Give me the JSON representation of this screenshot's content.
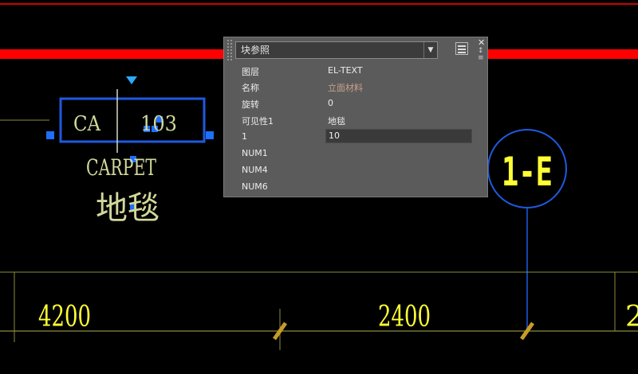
{
  "cad": {
    "block": {
      "left_text": "CA",
      "right_text": "103",
      "label_en": "CARPET",
      "label_cn": "地毯"
    },
    "grid_bubble": "1-E",
    "dimensions": [
      "4200",
      "2400"
    ],
    "colors": {
      "red_line": "#ff0000",
      "yellow": "#ffff33",
      "pale_yellow": "#d2d89a",
      "blue": "#1e5adf",
      "grip_blue": "#1f6fff",
      "olive": "#8d8b3c",
      "tick_brown": "#c79a2a"
    }
  },
  "palette": {
    "selected_type": "块参照",
    "rows": [
      {
        "label": "图层",
        "value": "EL-TEXT"
      },
      {
        "label": "名称",
        "value": "立面材料"
      },
      {
        "label": "旋转",
        "value": "0"
      },
      {
        "label": "可见性1",
        "value": "地毯"
      },
      {
        "label": "1",
        "value": "10"
      },
      {
        "label": "NUM1",
        "value": ""
      },
      {
        "label": "NUM4",
        "value": ""
      },
      {
        "label": "NUM6",
        "value": ""
      }
    ],
    "icons": {
      "close": "close-icon",
      "pin": "pin-icon",
      "menu": "menu-icon",
      "select": "select-objects-icon"
    }
  }
}
